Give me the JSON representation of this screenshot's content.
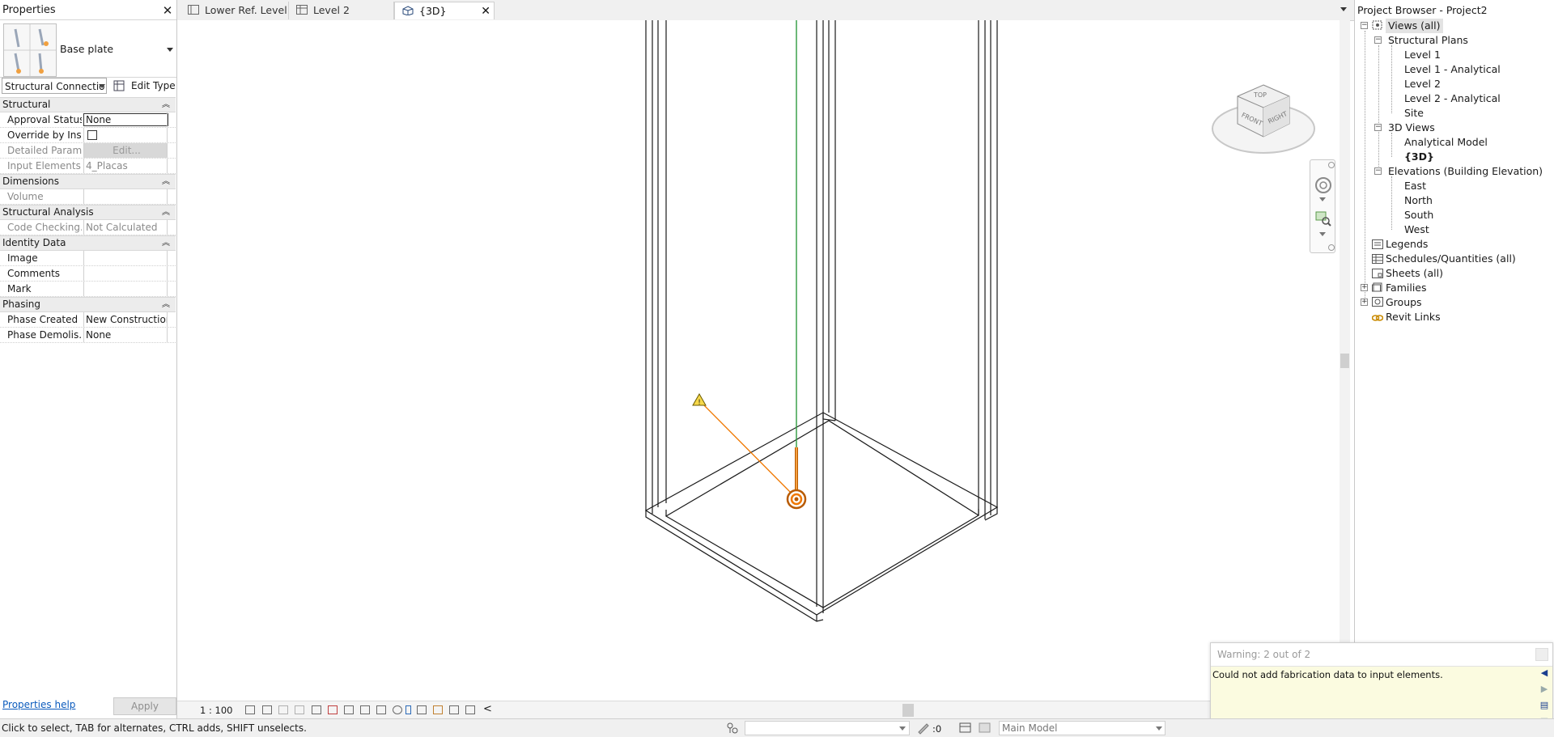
{
  "properties": {
    "title": "Properties",
    "type_name": "Base plate",
    "filter_value": "Structural Connectio",
    "edit_type_label": "Edit Type",
    "groups": {
      "structural": "Structural",
      "dimensions": "Dimensions",
      "analysis": "Structural Analysis",
      "identity": "Identity Data",
      "phasing": "Phasing"
    },
    "rows": {
      "approval_status": {
        "label": "Approval Status",
        "value": "None"
      },
      "override": {
        "label": "Override by Inst..."
      },
      "detailed": {
        "label": "Detailed Param...",
        "value": "Edit..."
      },
      "input_elements": {
        "label": "Input Elements",
        "value": "4_Placas"
      },
      "volume": {
        "label": "Volume",
        "value": ""
      },
      "code_checking": {
        "label": "Code Checking...",
        "value": "Not Calculated"
      },
      "image": {
        "label": "Image",
        "value": ""
      },
      "comments": {
        "label": "Comments",
        "value": ""
      },
      "mark": {
        "label": "Mark",
        "value": ""
      },
      "phase_created": {
        "label": "Phase Created",
        "value": "New Construction"
      },
      "phase_demolished": {
        "label": "Phase Demolis...",
        "value": "None"
      }
    },
    "help_label": "Properties help",
    "apply_label": "Apply"
  },
  "tabs": [
    {
      "label": "Lower Ref. Level"
    },
    {
      "label": "Level 2"
    },
    {
      "label": "{3D}"
    }
  ],
  "viewcube": {
    "top": "TOP",
    "front": "FRONT",
    "right": "RIGHT"
  },
  "viewbar": {
    "scale": "1 : 100"
  },
  "browser": {
    "title": "Project Browser - Project2",
    "items": {
      "views_all": "Views (all)",
      "structural_plans": "Structural Plans",
      "level1": "Level 1",
      "level1_analytical": "Level 1 - Analytical",
      "level2": "Level 2",
      "level2_analytical": "Level 2 - Analytical",
      "site": "Site",
      "views_3d": "3D Views",
      "analytical_model": "Analytical Model",
      "view_3d": "{3D}",
      "elevations": "Elevations (Building Elevation)",
      "east": "East",
      "north": "North",
      "south": "South",
      "west": "West",
      "legends": "Legends",
      "schedules": "Schedules/Quantities (all)",
      "sheets": "Sheets (all)",
      "families": "Families",
      "groups": "Groups",
      "revit_links": "Revit Links"
    }
  },
  "warning": {
    "title": "Warning: 2 out of 2",
    "message": "Could not add fabrication data to input elements."
  },
  "status": {
    "hint": "Click to select, TAB for alternates, CTRL adds, SHIFT unselects.",
    "filter_count": ":0",
    "model": "Main Model"
  },
  "colors": {
    "accent_orange": "#f07800",
    "analytical_green": "#2e9a3e",
    "warning_bg": "#fbfbe0",
    "link_blue": "#0b5bbd"
  }
}
